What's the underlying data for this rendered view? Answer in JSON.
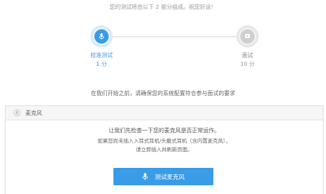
{
  "header": {
    "notice": "您的测试将由以下 2 部分组成。祝您好运！"
  },
  "steps": [
    {
      "name": "校准测试",
      "time": "1 分",
      "status": "active",
      "icon": "microphone-icon"
    },
    {
      "name": "面试",
      "time": "10 分",
      "status": "pending",
      "icon": "interview-icon"
    }
  ],
  "prep_text": "在我们开始之前，请确保您的系统配置符合参与面试的要求",
  "panel": {
    "title": "麦克风",
    "icon": "microphone-icon",
    "line1": "让我们先检查一下您的麦克风是否正常运作。",
    "line2": "如果您尚未插入入耳式耳机/头戴式耳机（含内置麦克风），",
    "line3": "请立即插入并刷新页面。",
    "button_label": "测试麦克风"
  },
  "colors": {
    "accent": "#3a9be6",
    "inactive": "#cfcfcf"
  }
}
